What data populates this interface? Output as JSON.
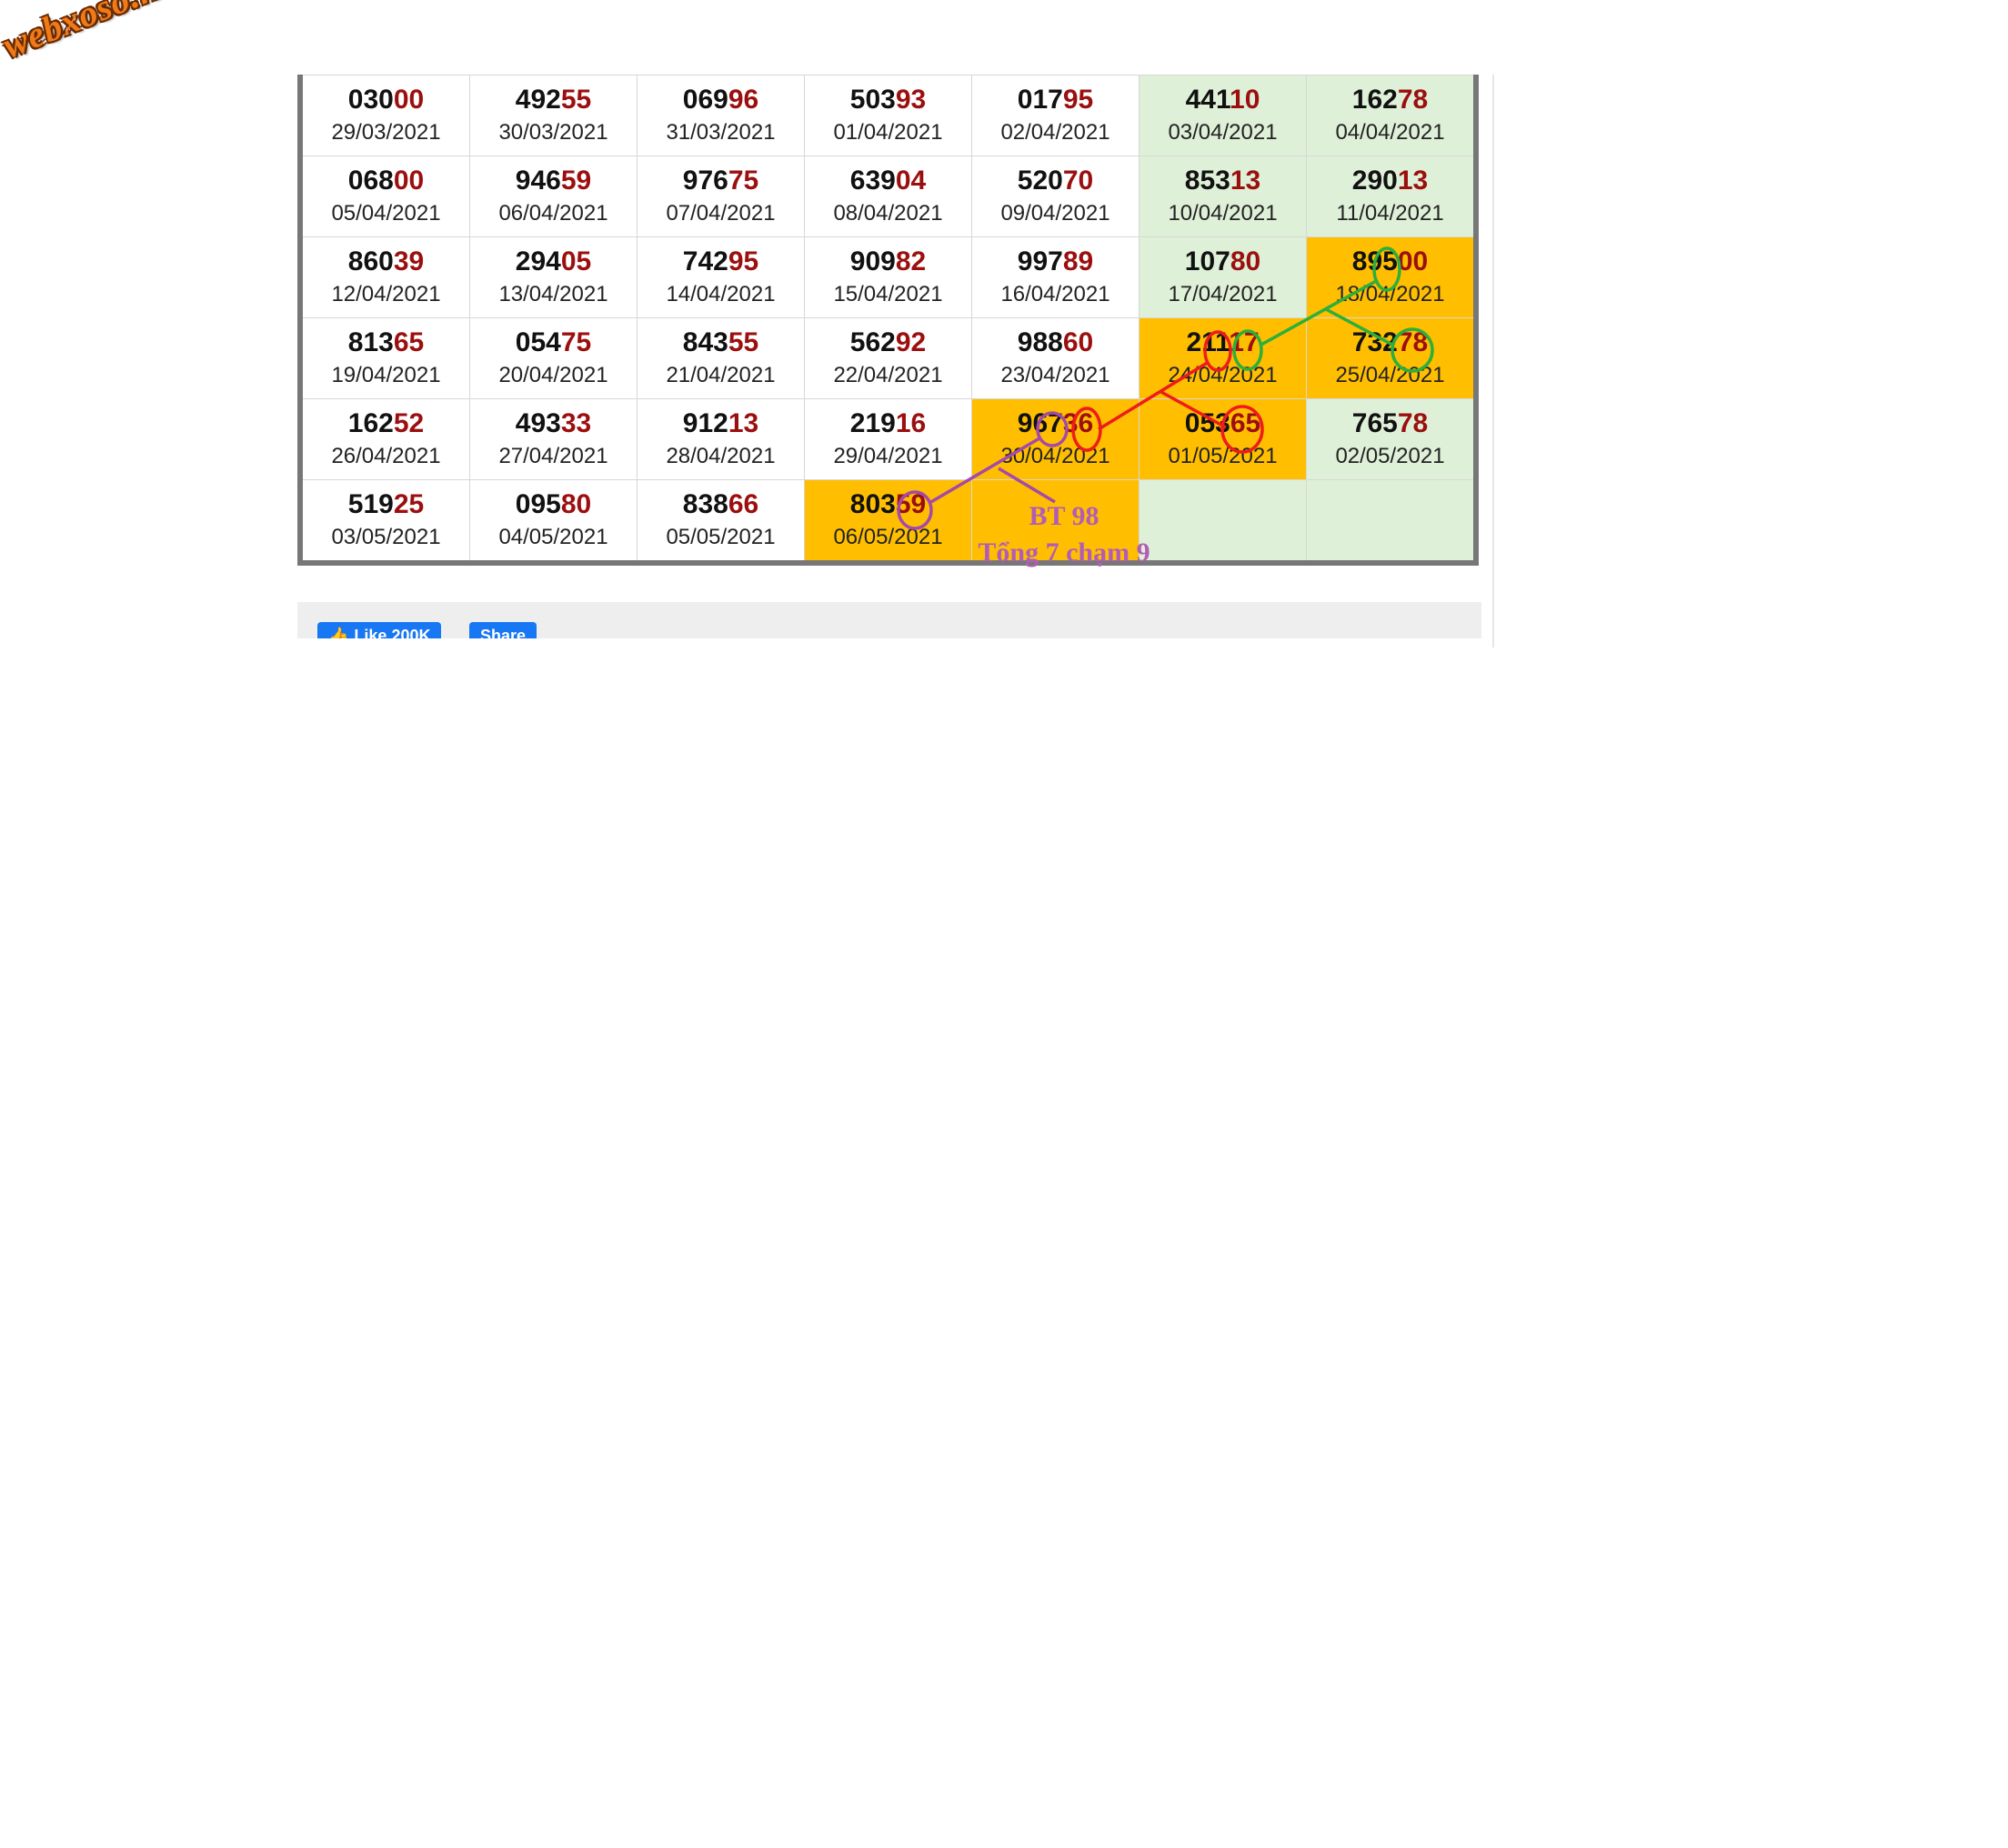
{
  "logo": {
    "text": "webxoso.net"
  },
  "table": {
    "rows": [
      [
        {
          "head": "030",
          "tail": "00",
          "date": "29/03/2021",
          "bg": "white"
        },
        {
          "head": "492",
          "tail": "55",
          "date": "30/03/2021",
          "bg": "white"
        },
        {
          "head": "069",
          "tail": "96",
          "date": "31/03/2021",
          "bg": "white"
        },
        {
          "head": "503",
          "tail": "93",
          "date": "01/04/2021",
          "bg": "white"
        },
        {
          "head": "017",
          "tail": "95",
          "date": "02/04/2021",
          "bg": "white"
        },
        {
          "head": "441",
          "tail": "10",
          "date": "03/04/2021",
          "bg": "green"
        },
        {
          "head": "162",
          "tail": "78",
          "date": "04/04/2021",
          "bg": "green"
        }
      ],
      [
        {
          "head": "068",
          "tail": "00",
          "date": "05/04/2021",
          "bg": "white"
        },
        {
          "head": "946",
          "tail": "59",
          "date": "06/04/2021",
          "bg": "white"
        },
        {
          "head": "976",
          "tail": "75",
          "date": "07/04/2021",
          "bg": "white"
        },
        {
          "head": "639",
          "tail": "04",
          "date": "08/04/2021",
          "bg": "white"
        },
        {
          "head": "520",
          "tail": "70",
          "date": "09/04/2021",
          "bg": "white"
        },
        {
          "head": "853",
          "tail": "13",
          "date": "10/04/2021",
          "bg": "green"
        },
        {
          "head": "290",
          "tail": "13",
          "date": "11/04/2021",
          "bg": "green"
        }
      ],
      [
        {
          "head": "860",
          "tail": "39",
          "date": "12/04/2021",
          "bg": "white"
        },
        {
          "head": "294",
          "tail": "05",
          "date": "13/04/2021",
          "bg": "white"
        },
        {
          "head": "742",
          "tail": "95",
          "date": "14/04/2021",
          "bg": "white"
        },
        {
          "head": "909",
          "tail": "82",
          "date": "15/04/2021",
          "bg": "white"
        },
        {
          "head": "997",
          "tail": "89",
          "date": "16/04/2021",
          "bg": "white"
        },
        {
          "head": "107",
          "tail": "80",
          "date": "17/04/2021",
          "bg": "green"
        },
        {
          "head": "895",
          "tail": "00",
          "date": "18/04/2021",
          "bg": "orange"
        }
      ],
      [
        {
          "head": "813",
          "tail": "65",
          "date": "19/04/2021",
          "bg": "white"
        },
        {
          "head": "054",
          "tail": "75",
          "date": "20/04/2021",
          "bg": "white"
        },
        {
          "head": "843",
          "tail": "55",
          "date": "21/04/2021",
          "bg": "white"
        },
        {
          "head": "562",
          "tail": "92",
          "date": "22/04/2021",
          "bg": "white"
        },
        {
          "head": "988",
          "tail": "60",
          "date": "23/04/2021",
          "bg": "white"
        },
        {
          "head": "211",
          "tail": "17",
          "date": "24/04/2021",
          "bg": "orange"
        },
        {
          "head": "732",
          "tail": "78",
          "date": "25/04/2021",
          "bg": "orange"
        }
      ],
      [
        {
          "head": "162",
          "tail": "52",
          "date": "26/04/2021",
          "bg": "white"
        },
        {
          "head": "493",
          "tail": "33",
          "date": "27/04/2021",
          "bg": "white"
        },
        {
          "head": "912",
          "tail": "13",
          "date": "28/04/2021",
          "bg": "white"
        },
        {
          "head": "219",
          "tail": "16",
          "date": "29/04/2021",
          "bg": "white"
        },
        {
          "head": "967",
          "tail": "36",
          "date": "30/04/2021",
          "bg": "orange"
        },
        {
          "head": "053",
          "tail": "65",
          "date": "01/05/2021",
          "bg": "orange"
        },
        {
          "head": "765",
          "tail": "78",
          "date": "02/05/2021",
          "bg": "green"
        }
      ],
      [
        {
          "head": "519",
          "tail": "25",
          "date": "03/05/2021",
          "bg": "white"
        },
        {
          "head": "095",
          "tail": "80",
          "date": "04/05/2021",
          "bg": "white"
        },
        {
          "head": "838",
          "tail": "66",
          "date": "05/05/2021",
          "bg": "white"
        },
        {
          "head": "803",
          "tail": "59",
          "date": "06/05/2021",
          "bg": "orange"
        },
        {
          "head": "",
          "tail": "",
          "date": "",
          "bg": "orange"
        },
        {
          "head": "",
          "tail": "",
          "date": "",
          "bg": "green"
        },
        {
          "head": "",
          "tail": "",
          "date": "",
          "bg": "green"
        }
      ]
    ],
    "colors": {
      "green_bg": "#dff0d8",
      "orange_bg": "#ffbf00",
      "tail_digits": "#9b0f0f",
      "annotation_purple": "#b15db7",
      "annotation_red": "#ee1c1c",
      "annotation_green": "#2eae3a"
    }
  },
  "annotation": {
    "line1": "BT 98",
    "line2": "Tổng 7 chạm 9"
  },
  "social": {
    "like_label": "Like 200K",
    "share_label": "Share",
    "like_icon": "thumbs-up-icon"
  }
}
